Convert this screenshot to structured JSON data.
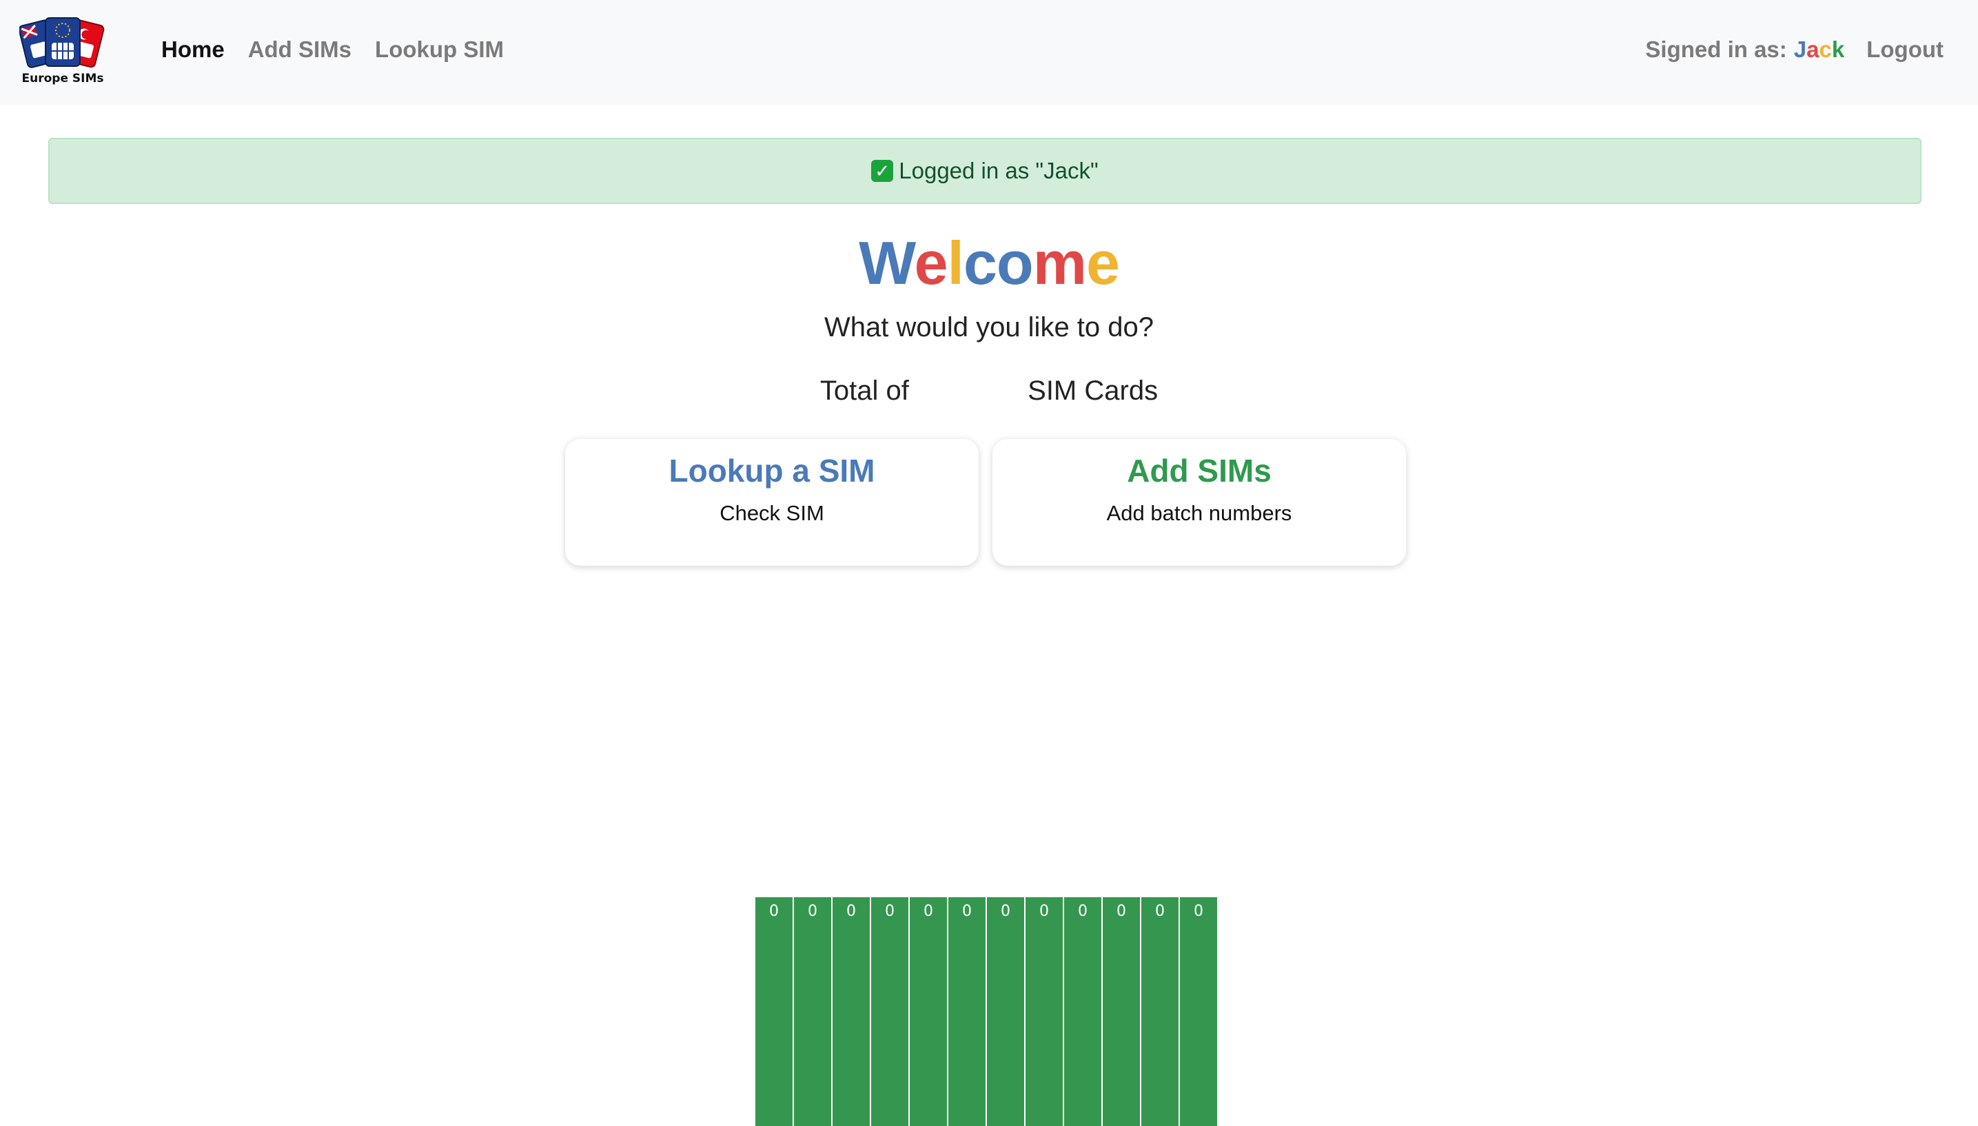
{
  "brand": {
    "name": "Europe SIMs"
  },
  "nav": {
    "links": [
      {
        "label": "Home",
        "active": true
      },
      {
        "label": "Add SIMs",
        "active": false
      },
      {
        "label": "Lookup SIM",
        "active": false
      }
    ],
    "signed_in_label": "Signed in as:",
    "user_name": "Jack",
    "user_name_colors": [
      "#4a7ab8",
      "#e04848",
      "#f0b432",
      "#2f9a4e"
    ],
    "logout_label": "Logout"
  },
  "alert": {
    "icon": "check-mark-icon",
    "text": "Logged in as \"Jack\""
  },
  "welcome": {
    "title": "Welcome",
    "title_colors": [
      "#4a7ab8",
      "#e04848",
      "#f0b432",
      "#4a7ab8",
      "#4a7ab8",
      "#e04848",
      "#f0b432"
    ],
    "subtitle": "What would you like to do?",
    "total_prefix": "Total of",
    "total_value": "",
    "total_suffix": "SIM Cards"
  },
  "cards": [
    {
      "title": "Lookup a SIM",
      "description": "Check SIM",
      "color": "#4a7ab8"
    },
    {
      "title": "Add SIMs",
      "description": "Add batch numbers",
      "color": "#2f9a4e"
    }
  ],
  "chart_data": {
    "type": "bar",
    "values": [
      0,
      0,
      0,
      0,
      0,
      0,
      0,
      0,
      0,
      0,
      0,
      0
    ],
    "bar_color": "#35974f"
  }
}
